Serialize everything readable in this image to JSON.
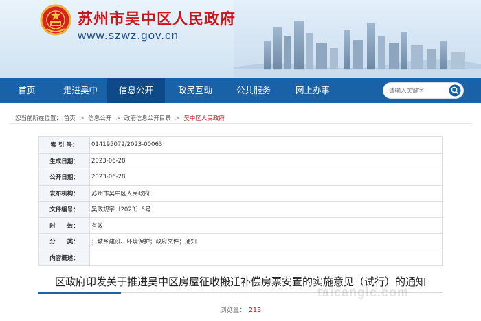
{
  "header": {
    "site_title": "苏州市吴中区人民政府",
    "site_url": "www.szwz.gov.cn"
  },
  "nav": {
    "items": [
      {
        "label": "首页"
      },
      {
        "label": "走进吴中"
      },
      {
        "label": "信息公开",
        "active": true
      },
      {
        "label": "政民互动"
      },
      {
        "label": "公共服务"
      },
      {
        "label": "网上办事"
      }
    ],
    "search_placeholder": "请输入关键字"
  },
  "breadcrumb": {
    "prefix": "您当前所在位置：",
    "items": [
      "首页",
      "信息公开",
      "政府信息公开目录"
    ],
    "current": "吴中区人民政府",
    "separator": ">"
  },
  "meta": [
    {
      "key": "索 引 号：",
      "value": "014195072/2023-00063"
    },
    {
      "key": "生成日期：",
      "value": "2023-06-28"
    },
    {
      "key": "公开日期：",
      "value": "2023-06-28"
    },
    {
      "key": "发布机构：",
      "value": "苏州市吴中区人民政府"
    },
    {
      "key": "文件编号：",
      "value": "吴政规字〔2023〕5号"
    },
    {
      "key": "时　　效：",
      "value": "有效"
    },
    {
      "key": "分　　类：",
      "value": "；城乡建设、环境保护；政府文件；通知"
    },
    {
      "key": "内容概述：",
      "value": ""
    }
  ],
  "document": {
    "title": "区政府印发关于推进吴中区房屋征收搬迁补偿房票安置的实施意见（试行）的通知",
    "views_label": "浏览量：",
    "views_count": "213"
  },
  "watermark": "taicanglc.com",
  "colors": {
    "nav_bg": "#1a62a8",
    "nav_active": "#0d4a87",
    "title_red": "#c8161d",
    "url_blue": "#1b4f8e"
  },
  "icons": {
    "emblem": "national-emblem-icon",
    "search": "search-icon"
  }
}
